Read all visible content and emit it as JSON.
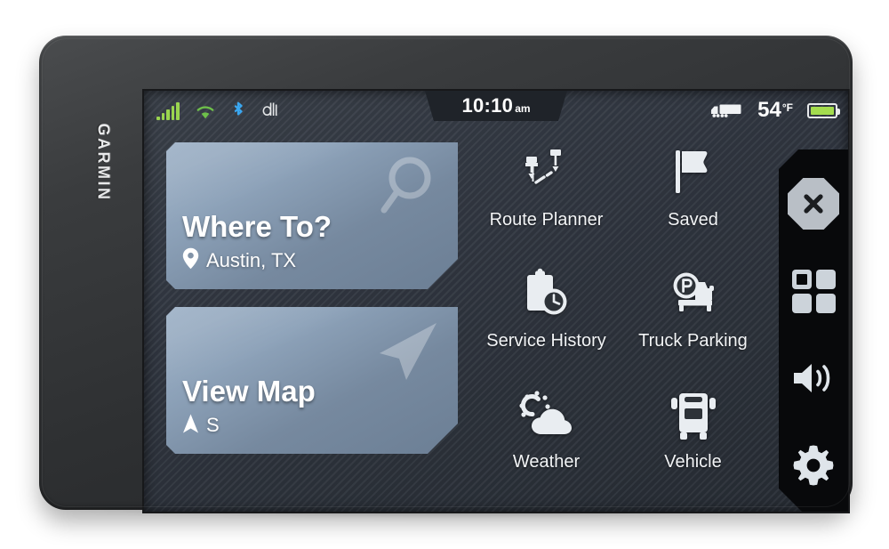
{
  "device": {
    "brand": "GARMIN"
  },
  "status_bar": {
    "signal_icon": "cellular-signal-icon",
    "signal_bars": 5,
    "wifi_icon": "wifi-icon",
    "bluetooth_icon": "bluetooth-icon",
    "app_icon": "dezl-app-icon",
    "app_icon_glyph": "d",
    "clock": {
      "time": "10:10",
      "ampm": "am"
    },
    "truck_icon": "truck-profile-icon",
    "temperature": {
      "value": "54",
      "unit": "°F"
    },
    "battery_icon": "battery-full-icon",
    "battery_level": 100,
    "colors": {
      "signal_green": "#9ad44f",
      "bluetooth_blue": "#3aa7f0",
      "wifi_green": "#6ec04a",
      "battery_green": "#a4dc4e"
    }
  },
  "tiles": [
    {
      "name": "where-to-tile",
      "title": "Where To?",
      "subtitle": "Austin, TX",
      "sub_icon": "location-pin-icon",
      "big_icon": "magnifier-icon"
    },
    {
      "name": "view-map-tile",
      "title": "View Map",
      "subtitle": "S",
      "sub_icon": "heading-arrow-icon",
      "big_icon": "navigation-arrow-icon"
    }
  ],
  "apps": [
    {
      "label": "Route Planner",
      "icon": "route-planner-icon"
    },
    {
      "label": "Saved",
      "icon": "flag-icon"
    },
    {
      "label": "Service History",
      "icon": "clipboard-clock-icon"
    },
    {
      "label": "Truck Parking",
      "icon": "truck-parking-icon"
    },
    {
      "label": "Weather",
      "icon": "sun-cloud-icon"
    },
    {
      "label": "Vehicle",
      "icon": "truck-front-icon"
    }
  ],
  "sidebar": {
    "buttons": [
      {
        "name": "close-button",
        "icon": "close-x-octagon-icon"
      },
      {
        "name": "apps-button",
        "icon": "grid-apps-icon"
      },
      {
        "name": "volume-button",
        "icon": "speaker-volume-icon"
      },
      {
        "name": "settings-button",
        "icon": "gear-icon"
      }
    ]
  }
}
